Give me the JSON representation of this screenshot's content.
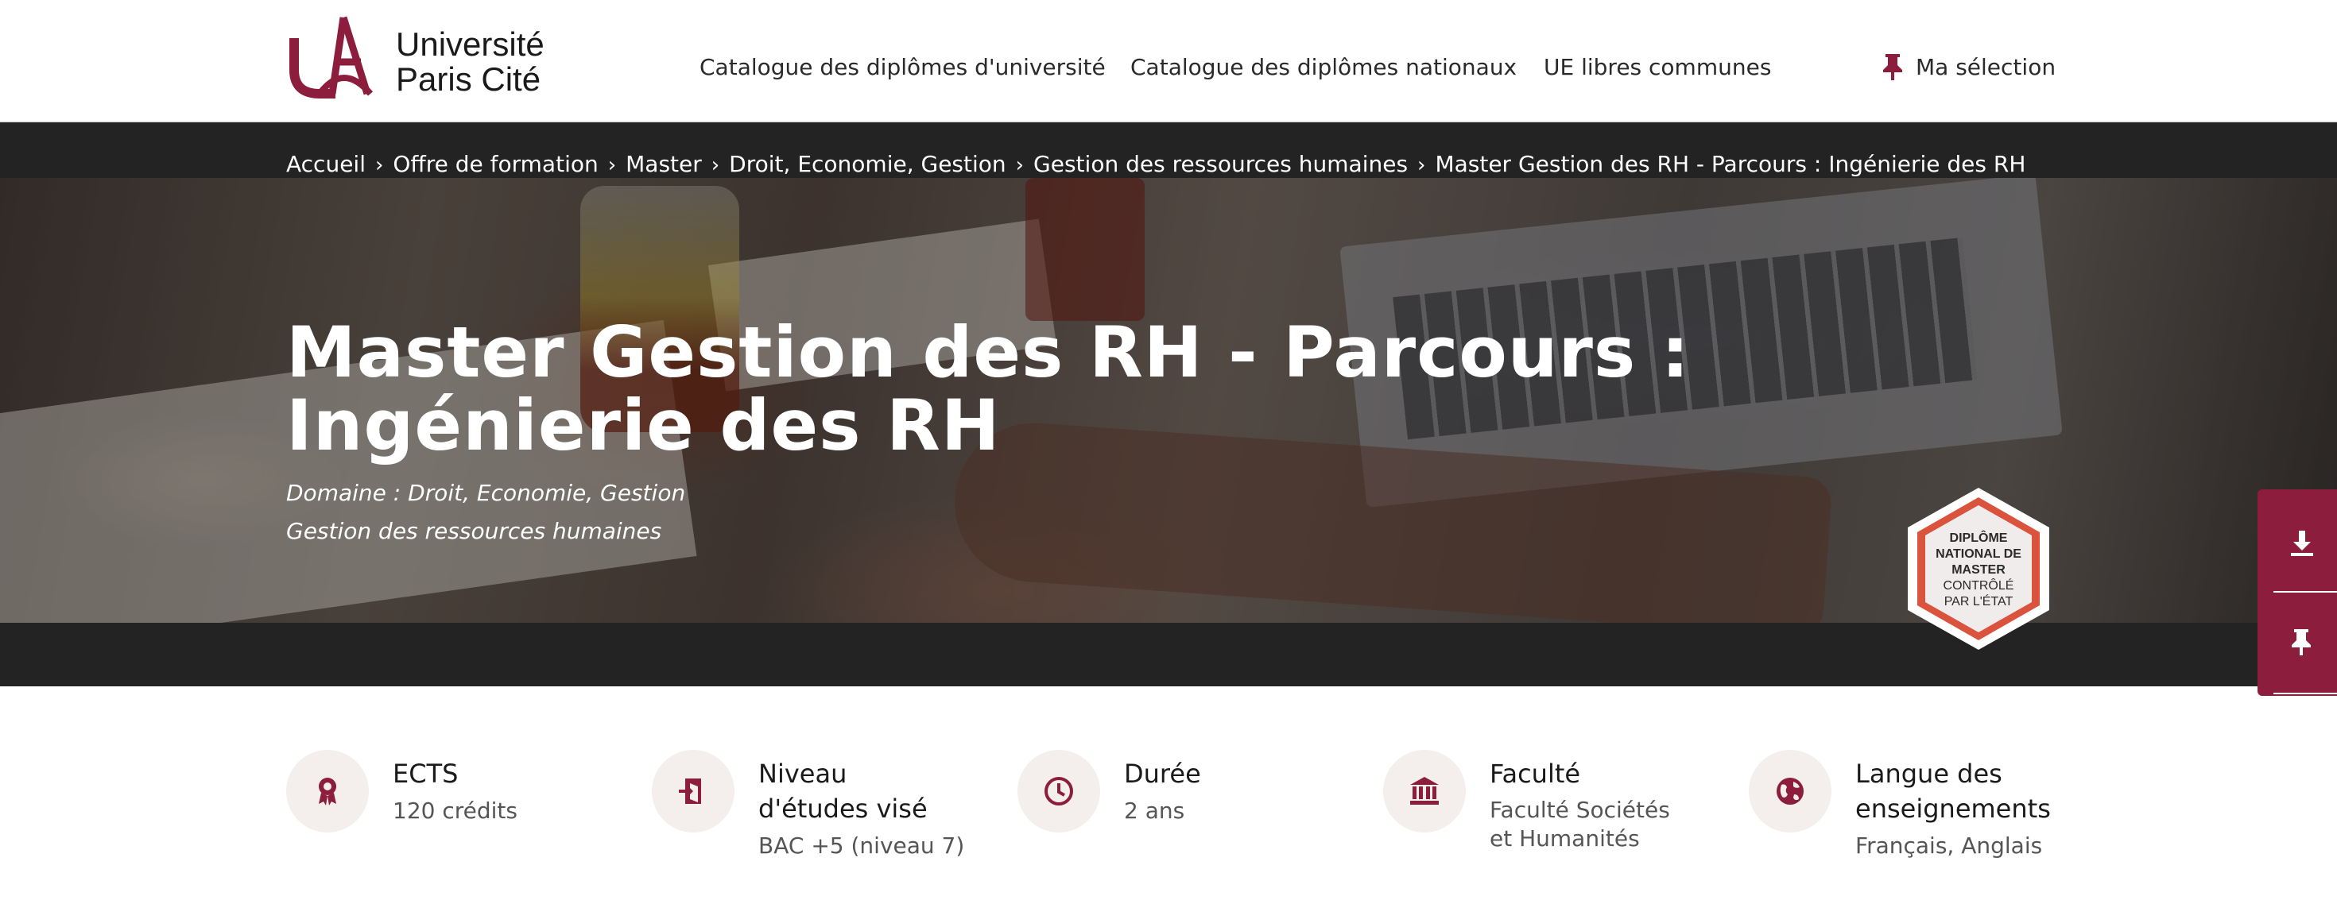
{
  "header": {
    "logo_line1": "Université",
    "logo_line2": "Paris Cité",
    "nav": [
      {
        "label": "Catalogue des diplômes d'université"
      },
      {
        "label": "Catalogue des diplômes nationaux"
      },
      {
        "label": "UE libres communes"
      }
    ],
    "selection_label": "Ma sélection"
  },
  "breadcrumb": [
    "Accueil",
    "Offre de formation",
    "Master",
    "Droit, Economie, Gestion",
    "Gestion des ressources humaines",
    "Master Gestion des RH - Parcours : Ingénierie des RH"
  ],
  "hero": {
    "title": "Master Gestion des RH - Parcours : Ingénierie des RH",
    "domain": "Domaine : Droit, Economie, Gestion",
    "subdomain": "Gestion des ressources humaines",
    "badge_line1": "DIPLÔME",
    "badge_line2": "NATIONAL DE",
    "badge_line3": "MASTER",
    "badge_line4": "CONTRÔLÉ",
    "badge_line5": "PAR L'ÉTAT"
  },
  "info": [
    {
      "label": "ECTS",
      "value": "120 crédits"
    },
    {
      "label_line1": "Niveau",
      "label_line2": "d'études visé",
      "value": "BAC +5 (niveau 7)"
    },
    {
      "label": "Durée",
      "value": "2 ans"
    },
    {
      "label": "Faculté",
      "value_line1": "Faculté Sociétés",
      "value_line2": "et Humanités"
    },
    {
      "label_line1": "Langue des",
      "label_line2": "enseignements",
      "value": "Français, Anglais"
    }
  ],
  "colors": {
    "brand": "#8c1d3c",
    "hero_bg": "#232323",
    "icon_circle": "#f4eeec"
  }
}
